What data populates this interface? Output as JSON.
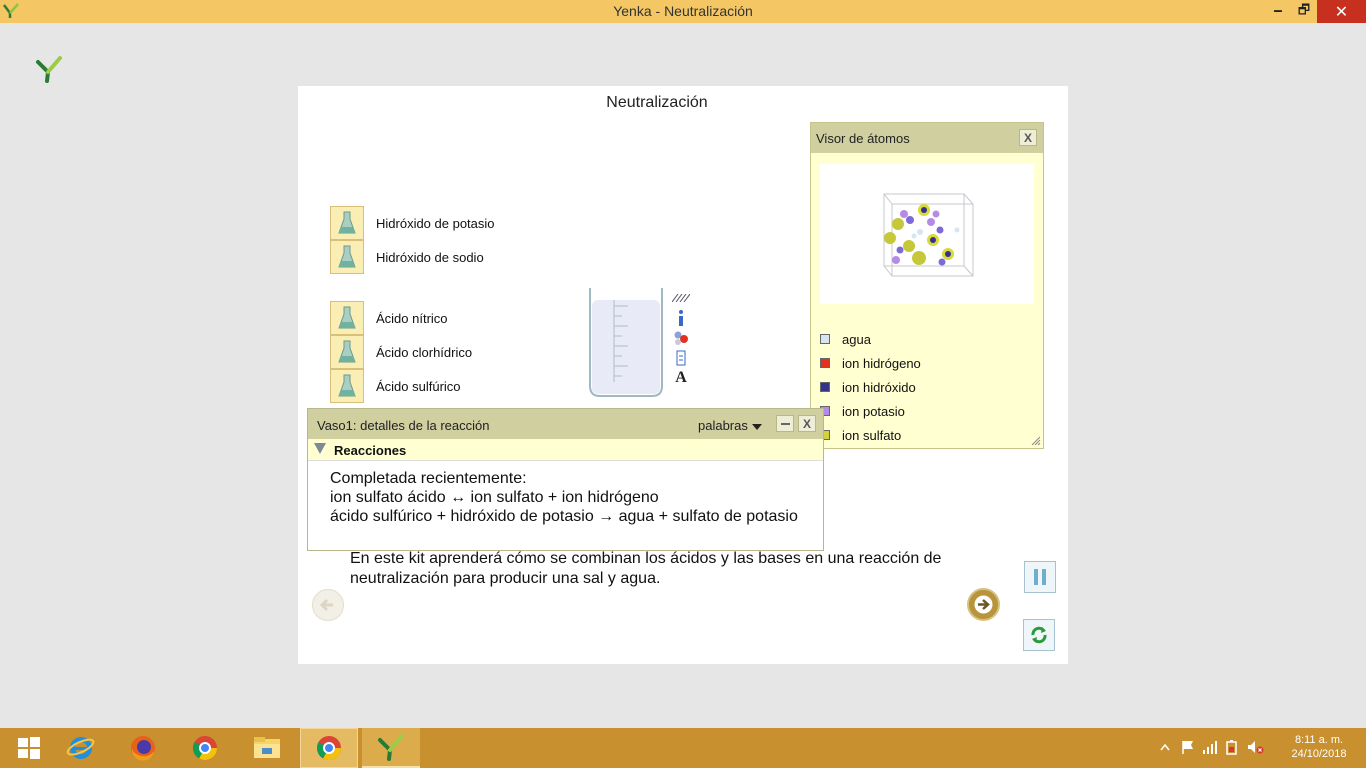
{
  "window": {
    "title": "Yenka - Neutralización",
    "minimize": "🗕",
    "maximize": "🗗",
    "close": "✕"
  },
  "panel": {
    "title": "Neutralización"
  },
  "bases": [
    {
      "label": "Hidróxido de potasio"
    },
    {
      "label": "Hidróxido de sodio"
    }
  ],
  "acids": [
    {
      "label": "Ácido nítrico"
    },
    {
      "label": "Ácido clorhídrico"
    },
    {
      "label": "Ácido sulfúrico"
    }
  ],
  "beaker_tools": {
    "text_tool": "A"
  },
  "atom_viewer": {
    "title": "Visor de átomos",
    "close": "X",
    "legend": [
      {
        "label": "agua",
        "color": "#d7e4f2"
      },
      {
        "label": "ion hidrógeno",
        "color": "#e0321e"
      },
      {
        "label": "ion hidróxido",
        "color": "#33338c"
      },
      {
        "label": "ion potasio",
        "color": "#b48ce6"
      },
      {
        "label": "ion sulfato",
        "color": "#d2d23c"
      }
    ]
  },
  "details": {
    "title": "Vaso1: detalles de la reacción",
    "mode": "palabras",
    "close": "X",
    "section": "Reacciones",
    "line1": "Completada recientemente:",
    "line2": "ion sulfato ácido ↔ ion sulfato + ion hidrógeno",
    "line3": "ácido sulfúrico + hidróxido de potasio → agua + sulfato de potasio"
  },
  "intro": "En este kit aprenderá cómo se combinan los ácidos y las bases en una reacción de neutralización para producir una sal y agua.",
  "taskbar": {
    "clock_time": "8:11 a. m.",
    "clock_date": "24/10/2018"
  }
}
